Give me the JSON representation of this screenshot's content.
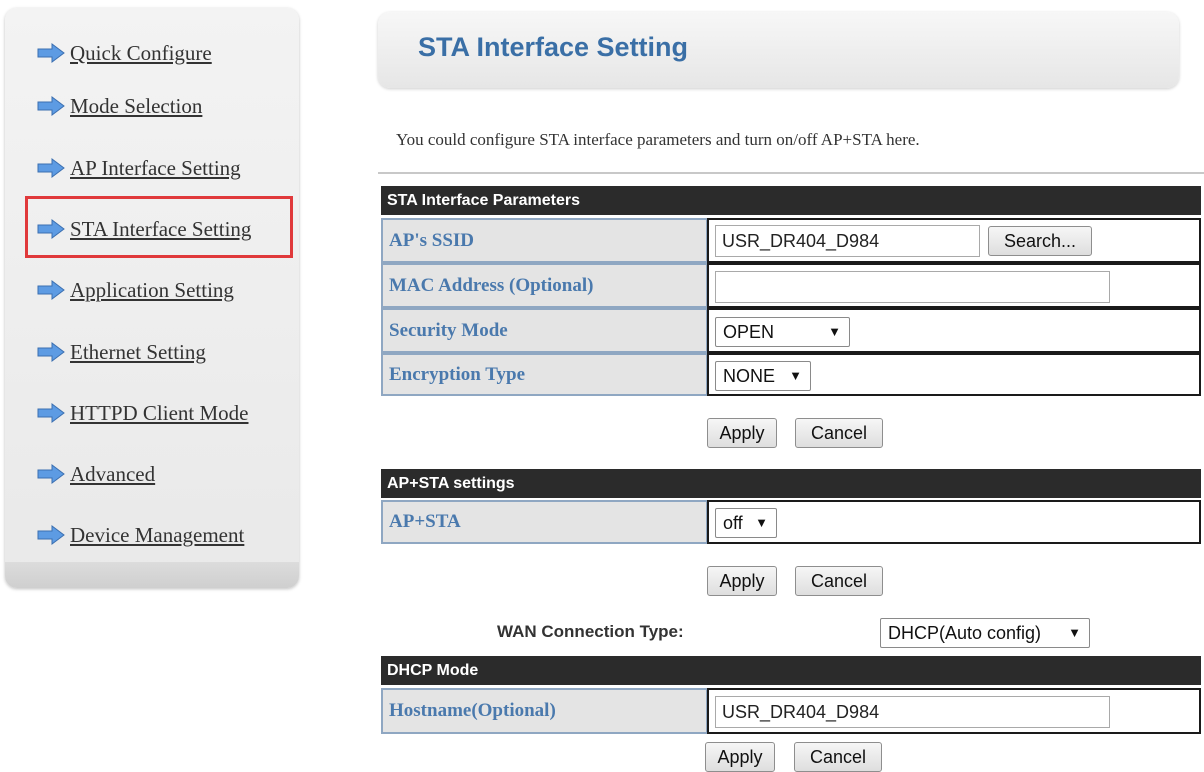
{
  "sidebar": {
    "items": [
      {
        "label": "Quick Configure"
      },
      {
        "label": "Mode Selection"
      },
      {
        "label": "AP Interface Setting"
      },
      {
        "label": "STA Interface Setting"
      },
      {
        "label": "Application Setting"
      },
      {
        "label": "Ethernet Setting"
      },
      {
        "label": "HTTPD Client Mode"
      },
      {
        "label": "Advanced"
      },
      {
        "label": "Device Management"
      }
    ],
    "selected": "STA Interface Setting",
    "highlight_color": "#e0393b",
    "icon": "blue-arrow-right-icon"
  },
  "header": {
    "title": "STA Interface Setting"
  },
  "intro": "You could configure STA interface parameters and turn on/off AP+STA here.",
  "sta_params": {
    "title": "STA Interface Parameters",
    "ssid_label": "AP's SSID",
    "ssid_value": "USR_DR404_D984",
    "search_label": "Search...",
    "mac_label": "MAC Address (Optional)",
    "mac_value": "",
    "security_label": "Security Mode",
    "security_value": "OPEN",
    "encryption_label": "Encryption Type",
    "encryption_value": "NONE",
    "apply_label": "Apply",
    "cancel_label": "Cancel"
  },
  "apsta": {
    "title": "AP+STA settings",
    "label": "AP+STA",
    "value": "off",
    "apply_label": "Apply",
    "cancel_label": "Cancel"
  },
  "wan": {
    "label": "WAN Connection Type:",
    "value": "DHCP(Auto config)"
  },
  "dhcp": {
    "title": "DHCP Mode",
    "hostname_label": "Hostname(Optional)",
    "hostname_value": "USR_DR404_D984",
    "apply_label": "Apply",
    "cancel_label": "Cancel"
  },
  "colors": {
    "section_header_bg": "#2b2b2b",
    "label_text": "#4a79ad",
    "title_text": "#3a6fa6"
  }
}
